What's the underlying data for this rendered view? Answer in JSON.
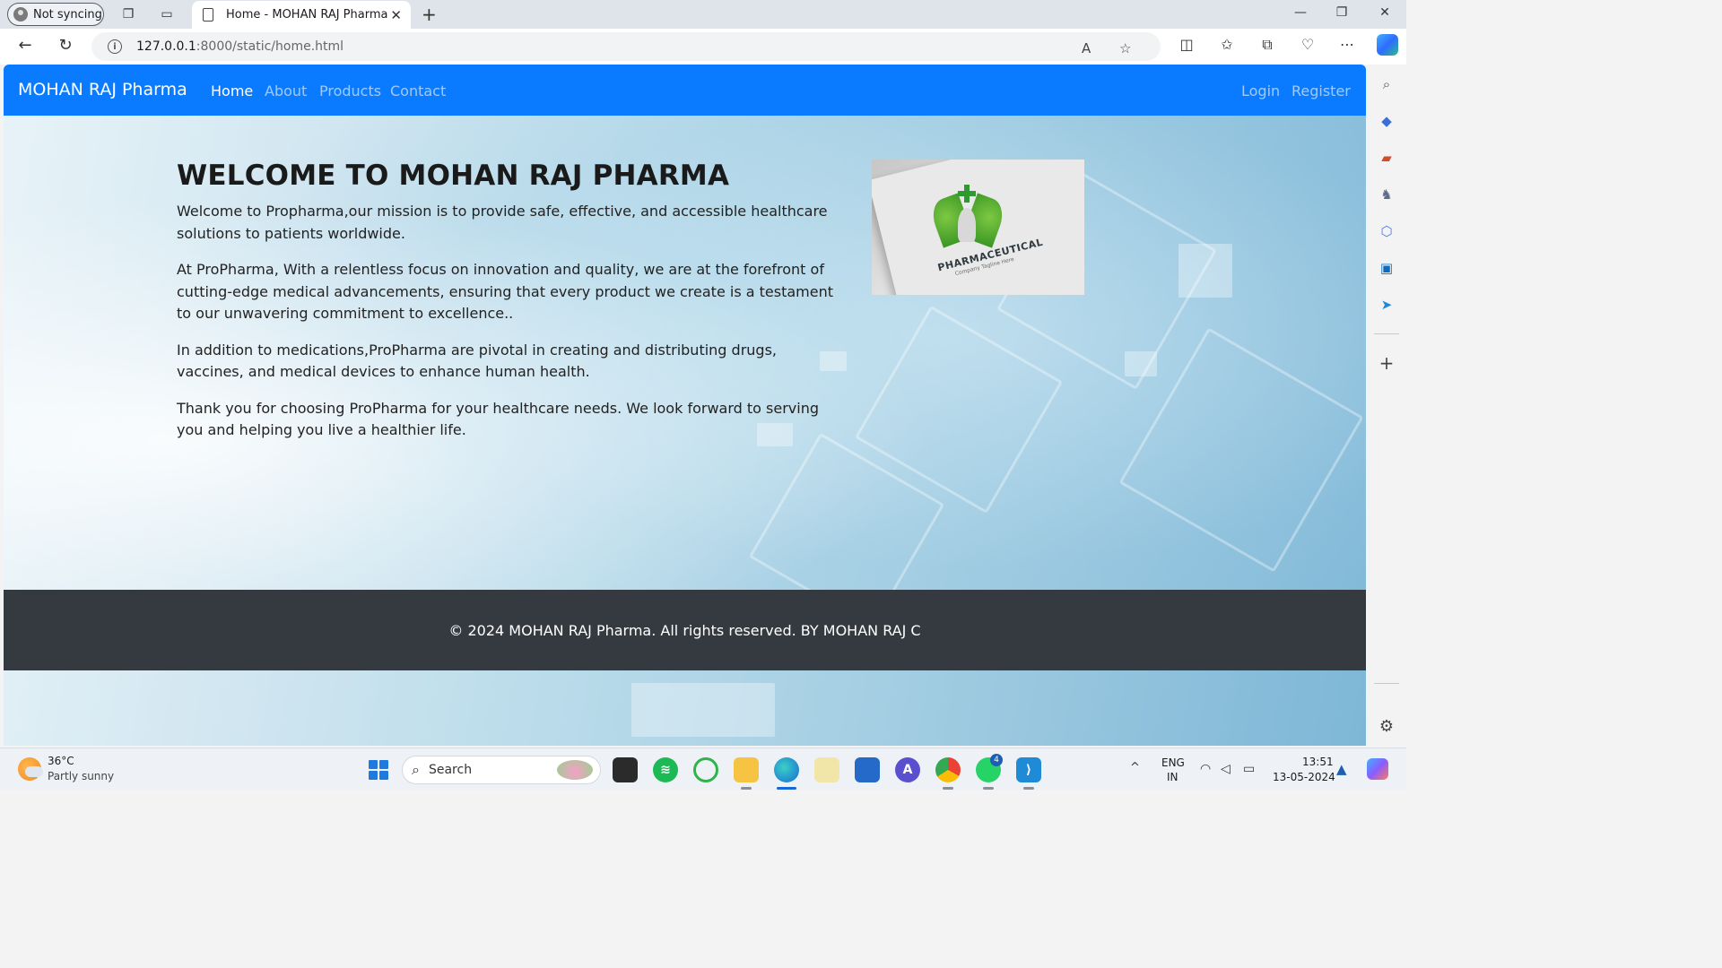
{
  "browser": {
    "profile_label": "Not syncing",
    "tab_title": "Home - MOHAN RAJ Pharma",
    "url_host": "127.0.0.1",
    "url_path": ":8000/static/home.html"
  },
  "site": {
    "brand": "MOHAN RAJ Pharma",
    "nav": {
      "home": "Home",
      "about": "About",
      "products": "Products",
      "contact": "Contact",
      "login": "Login",
      "register": "Register"
    },
    "hero": {
      "title": "WELCOME TO MOHAN RAJ PHARMA",
      "paragraphs": [
        "Welcome to Propharma,our mission is to provide safe, effective, and accessible healthcare solutions to patients worldwide.",
        "At ProPharma, With a relentless focus on innovation and quality, we are at the forefront of cutting-edge medical advancements, ensuring that every product we create is a testament to our unwavering commitment to excellence..",
        "In addition to medications,ProPharma are pivotal in creating and distributing drugs, vaccines, and medical devices to enhance human health.",
        "Thank you for choosing ProPharma for your healthcare needs. We look forward to serving you and helping you live a healthier life."
      ],
      "logo_text": "PHARMACEUTICAL",
      "logo_subtext": "Company Tagline Here"
    },
    "footer": "© 2024 MOHAN RAJ Pharma. All rights reserved. BY MOHAN RAJ C",
    "nav_color": "#0a7bff",
    "footer_color": "#343a40"
  },
  "taskbar": {
    "weather_temp": "36°C",
    "weather_desc": "Partly sunny",
    "search_label": "Search",
    "whatsapp_badge": "4",
    "lang_1": "ENG",
    "lang_2": "IN",
    "time": "13:51",
    "date": "13-05-2024"
  }
}
